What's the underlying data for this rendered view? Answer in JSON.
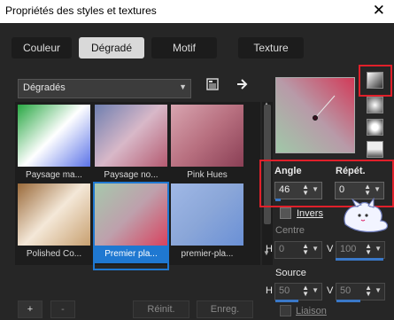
{
  "window": {
    "title": "Propriétés des styles et textures",
    "close": "✕"
  },
  "tabs": [
    "Couleur",
    "Dégradé",
    "Motif",
    "Texture"
  ],
  "selector": {
    "value": "Dégradés"
  },
  "gradients": [
    {
      "label": "Paysage ma...",
      "colors": [
        "#27a742",
        "#ffffff",
        "#5b73e8"
      ]
    },
    {
      "label": "Paysage no...",
      "colors": [
        "#6f7fb0",
        "#d8b8c8",
        "#b45a70"
      ]
    },
    {
      "label": "Pink Hues",
      "colors": [
        "#d8a5b0",
        "#b87080",
        "#8a3f55"
      ]
    },
    {
      "label": "Polished Co...",
      "colors": [
        "#9a6a3a",
        "#f4e8d8",
        "#c8a070"
      ]
    },
    {
      "label": "Premier pla...",
      "colors": [
        "#a6c8ac",
        "#bea0ac",
        "#d8425e"
      ]
    },
    {
      "label": "premier-pla...",
      "colors": [
        "#a0b8e6",
        "#8aa6d8",
        "#6a90d6"
      ]
    }
  ],
  "controls": {
    "angle_label": "Angle",
    "angle_value": "46",
    "repeat_label": "Répét.",
    "repeat_value": "0",
    "invert_label": "Invers",
    "center_label": "Centre",
    "h_label": "H",
    "v_label": "V",
    "center_h": "0",
    "center_v": "100",
    "source_label": "Source",
    "source_h": "50",
    "source_v": "50",
    "link_label": "Liaison"
  },
  "bottom": {
    "add": "+",
    "remove": "-",
    "reset": "Réinit.",
    "save": "Enreg."
  },
  "accent": "#1f78d1",
  "highlight_color": "#e0202a"
}
